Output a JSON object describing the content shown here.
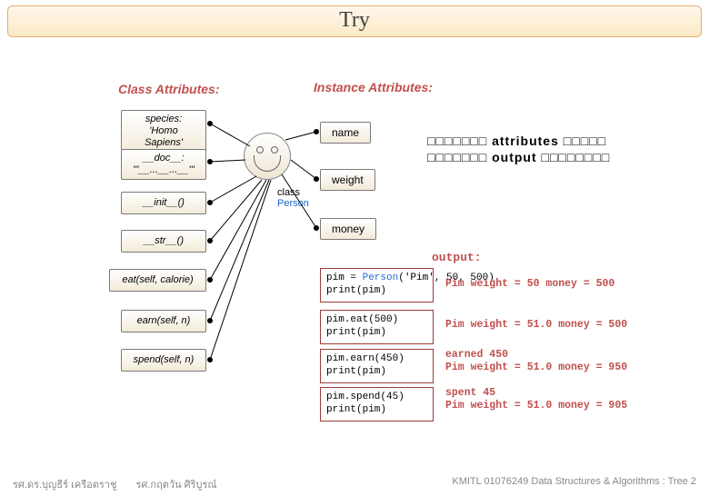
{
  "title": "Try",
  "headers": {
    "class": "Class Attributes:",
    "instance": "Instance Attributes:"
  },
  "class_attrs": {
    "species": {
      "label": "species:",
      "value": "'Homo Sapiens'"
    },
    "doc": {
      "label": "__doc__:",
      "value": "'''__...__...__'''"
    },
    "init": "__init__()",
    "str": "__str__()",
    "eat": "eat(self, calorie)",
    "earn": "earn(self, n)",
    "spend": "spend(self, n)"
  },
  "instance_attrs": {
    "name": "name",
    "weight": "weight",
    "money": "money"
  },
  "face": {
    "label_top": "class",
    "label_bottom": "Person"
  },
  "placeholder_note": {
    "line1_prefix": "□□□□□□□ ",
    "line1_kw": "attributes",
    "line1_suffix": " □□□□□",
    "line2_prefix": "□□□□□□□ ",
    "line2_kw": "output",
    "line2_suffix": " □□□□□□□□"
  },
  "output_header": "output:",
  "code": {
    "c1a": "pim = ",
    "c1cls": "Person",
    "c1b": "('Pim', 50, 500)\nprint(pim)",
    "c2": "pim.eat(500)\nprint(pim)",
    "c3": "pim.earn(450)\nprint(pim)",
    "c4": "pim.spend(45)\nprint(pim)"
  },
  "output": {
    "o1": "Pim weight = 50 money = 500",
    "o2": "Pim weight = 51.0 money = 500",
    "o3": "earned 450\nPim weight = 51.0 money = 950",
    "o4": "spent 45\nPim weight = 51.0 money = 905"
  },
  "footer": {
    "left1": "รศ.ดร.บุญธีร์    เครือตราชู",
    "left2": "รศ.กฤตวัน   ศิริบูรณ์",
    "right": "KMITL   01076249 Data Structures & Algorithms : Tree 2"
  }
}
